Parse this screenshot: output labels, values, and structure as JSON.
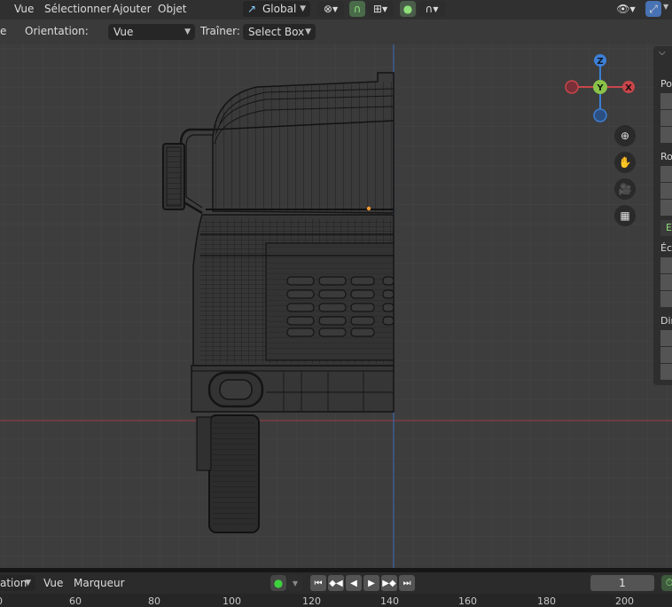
{
  "menu": {
    "view": "Vue",
    "select": "Sélectionner",
    "add": "Ajouter",
    "object": "Objet"
  },
  "header": {
    "transform_orientation": "Global"
  },
  "toolbar": {
    "left_clip": "e",
    "orientation_label": "Orientation:",
    "orientation_value": "Vue",
    "drag_label": "Traîner:",
    "drag_value": "Select Box"
  },
  "gizmo": {
    "z": "Z",
    "y": "Y",
    "x": "X"
  },
  "side_panel": {
    "position": "Pos",
    "rotation": "Rot",
    "euler_clip": "E",
    "scale": "Éch",
    "dimensions": "Dir"
  },
  "timeline": {
    "mode_clip": "ation",
    "view": "Vue",
    "marker": "Marqueur",
    "current_frame": "1",
    "ruler_ticks": [
      "60",
      "80",
      "100",
      "120",
      "140",
      "160",
      "180",
      "200"
    ]
  },
  "colors": {
    "x_axis": "#c8464a",
    "y_axis": "#8bc34a",
    "z_axis": "#3c7fd6",
    "selection": "#ff9a2e"
  }
}
